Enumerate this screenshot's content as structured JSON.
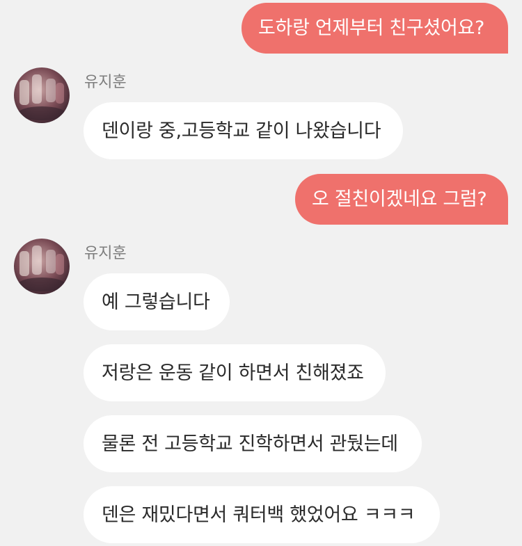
{
  "messages": {
    "out1": "도하랑 언제부터 친구셨어요?",
    "in1_sender": "유지훈",
    "in1": "덴이랑 중,고등학교 같이 나왔습니다",
    "out2": "오 절친이겠네요 그럼?",
    "in2_sender": "유지훈",
    "in2a": "예 그렇습니다",
    "in2b": "저랑은 운동 같이 하면서 친해졌죠",
    "in2c": "물론 전 고등학교 진학하면서 관뒀는데",
    "in2d": "덴은 재밌다면서 쿼터백 했었어요 ㅋㅋㅋ"
  },
  "colors": {
    "background": "#f1f1f1",
    "outgoing_bubble": "#ef716c",
    "incoming_bubble": "#ffffff"
  }
}
